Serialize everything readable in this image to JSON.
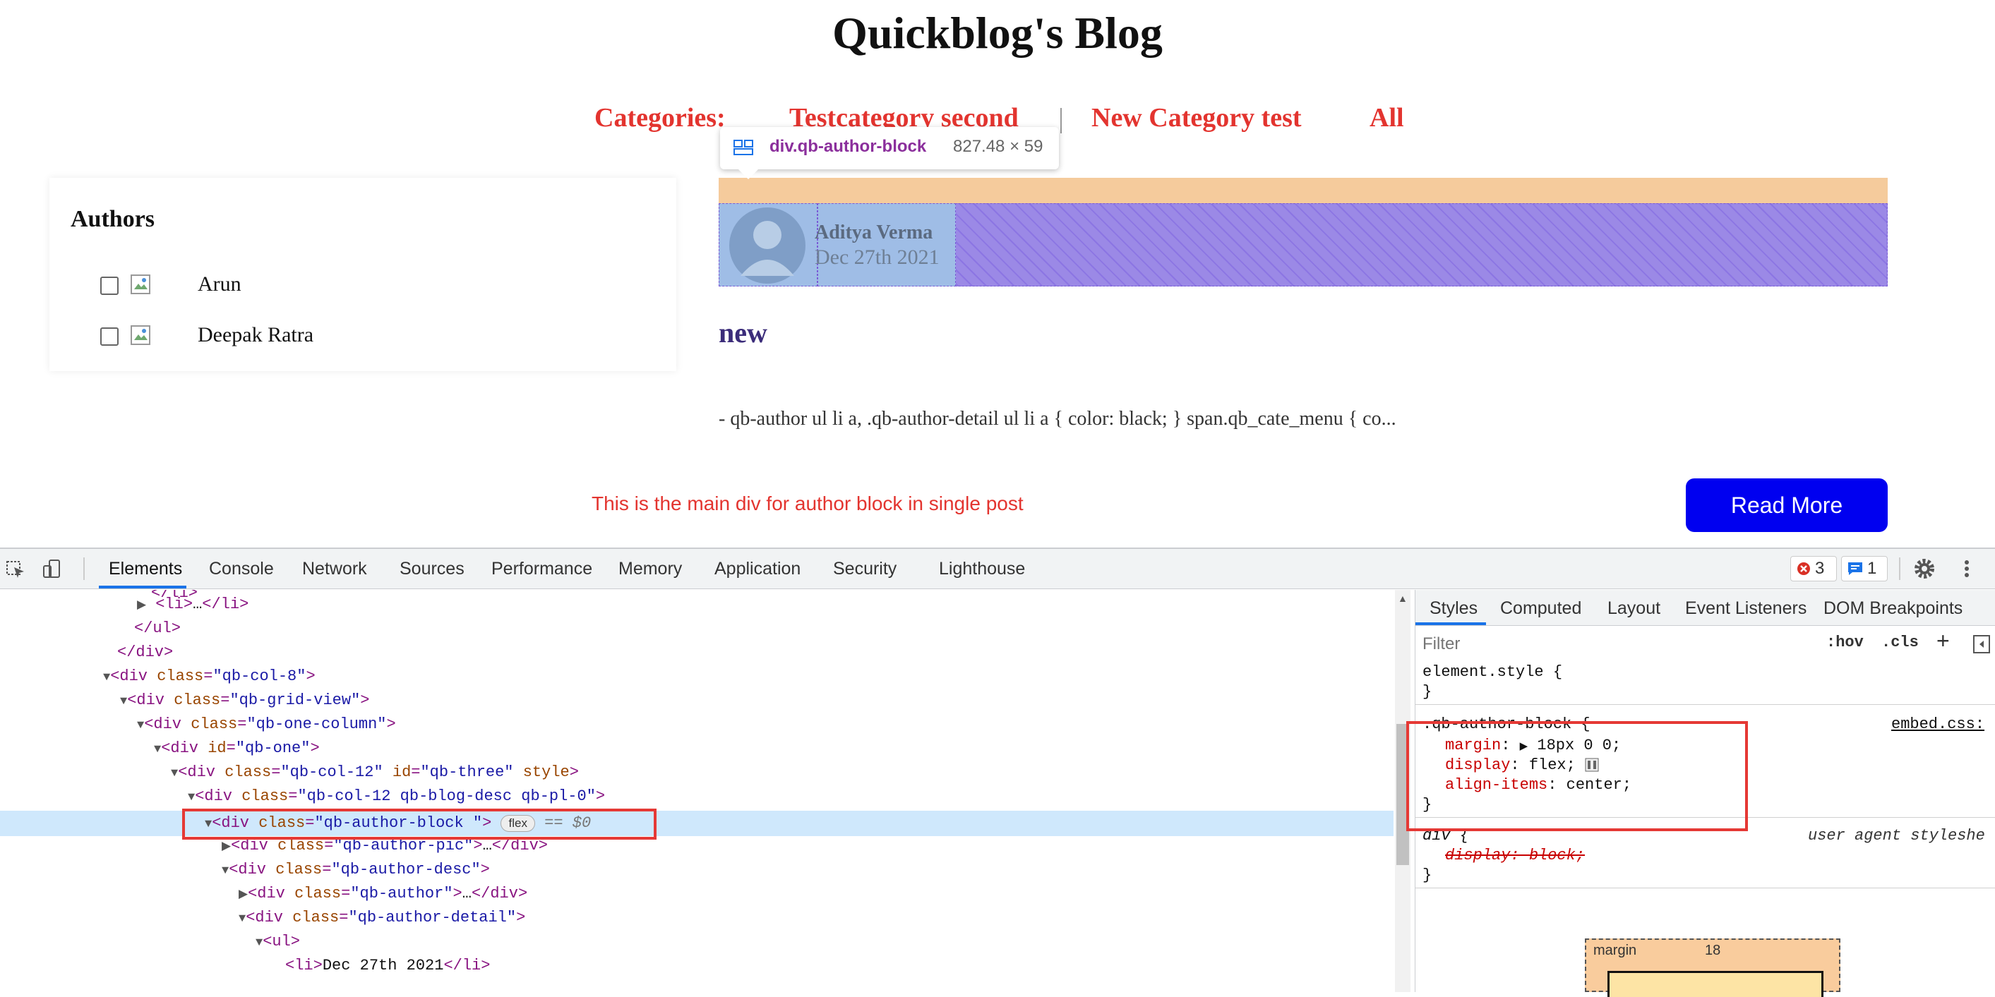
{
  "page": {
    "title": "Quickblog's Blog",
    "categories": {
      "label": "Categories:",
      "items": [
        "Testcategory second",
        "New Category test",
        "All"
      ]
    },
    "authors": {
      "title": "Authors",
      "items": [
        "Arun",
        "Deepak Ratra"
      ]
    },
    "tooltip": {
      "selector": "div.qb-author-block",
      "size": "827.48 × 59"
    },
    "author_block": {
      "name": "Aditya Verma",
      "date": "Dec 27th 2021"
    },
    "post": {
      "title": "new",
      "excerpt": "- qb-author ul li a, .qb-author-detail ul li a { color: black; } span.qb_cate_menu { co...",
      "read_more": "Read More"
    },
    "annotation": "This is the main div for author block in single post"
  },
  "devtools": {
    "tabs": [
      "Elements",
      "Console",
      "Network",
      "Sources",
      "Performance",
      "Memory",
      "Application",
      "Security",
      "Lighthouse"
    ],
    "active_tab": "Elements",
    "error_count": "3",
    "message_count": "1",
    "dom": {
      "l0": "</li>",
      "l1_tag": "<li>",
      "l1_ell": "…",
      "l1_close": "</li>",
      "l2": "</ul>",
      "l3": "</div>",
      "l4_cls": "\"qb-col-8\"",
      "l5_cls": "\"qb-grid-view\"",
      "l6_cls": "\"qb-one-column\"",
      "l7_id": "\"qb-one\"",
      "l8_cls": "\"qb-col-12\"",
      "l8_id": "\"qb-three\"",
      "l9_cls": "\"qb-col-12 qb-blog-desc qb-pl-0\"",
      "l10_cls": "\"qb-author-block \"",
      "l10_pill": "flex",
      "l10_eq": "== $0",
      "l11_cls": "\"qb-author-pic\"",
      "l11_ell": "…",
      "l12_cls": "\"qb-author-desc\"",
      "l13_cls": "\"qb-author\"",
      "l13_ell": "…",
      "l14_cls": "\"qb-author-detail\"",
      "l15": "<ul>",
      "l16_open": "<li>",
      "l16_text": "Dec 27th 2021",
      "l16_close": "</li>"
    },
    "styles": {
      "tabs": [
        "Styles",
        "Computed",
        "Layout",
        "Event Listeners",
        "DOM Breakpoints"
      ],
      "filter_placeholder": "Filter",
      "hov": ":hov",
      "cls": ".cls",
      "element_style": "element.style {",
      "close_brace": "}",
      "rule_selector": ".qb-author-block {",
      "rule_source": "embed.css:",
      "margin_prop": "margin",
      "margin_val": "18px 0 0;",
      "display_prop": "display",
      "display_val": "flex;",
      "align_prop": "align-items",
      "align_val": "center;",
      "ua_selector": "div {",
      "ua_source": "user agent styleshe",
      "ua_display": "display: block;",
      "box_margin_label": "margin",
      "box_margin_val": "18"
    }
  }
}
